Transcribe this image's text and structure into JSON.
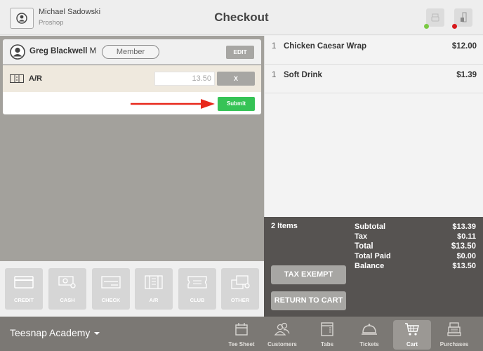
{
  "header": {
    "user_name": "Michael Sadowski",
    "user_role": "Proshop",
    "title": "Checkout",
    "printer_status_color": "#7ac943",
    "drawer_status_color": "#d7191c"
  },
  "customer": {
    "name": "Greg Blackwell",
    "suffix": "M",
    "badge": "Member",
    "edit_label": "EDIT"
  },
  "payment": {
    "method": "A/R",
    "amount": "13.50",
    "remove_label": "X",
    "submit_label": "Submit"
  },
  "tenders": [
    {
      "label": "CREDIT",
      "icon": "credit-card-icon"
    },
    {
      "label": "CASH",
      "icon": "cash-icon"
    },
    {
      "label": "CHECK",
      "icon": "check-icon"
    },
    {
      "label": "A/R",
      "icon": "ar-ledger-icon"
    },
    {
      "label": "CLUB",
      "icon": "club-ticket-icon"
    },
    {
      "label": "OTHER",
      "icon": "other-cards-icon"
    }
  ],
  "cart": {
    "items": [
      {
        "qty": "1",
        "name": "Chicken Caesar Wrap",
        "price": "$12.00"
      },
      {
        "qty": "1",
        "name": "Soft Drink",
        "price": "$1.39"
      }
    ]
  },
  "summary": {
    "items_count": "2 Items",
    "subtotal_label": "Subtotal",
    "subtotal": "$13.39",
    "tax_label": "Tax",
    "tax": "$0.11",
    "total_label": "Total",
    "total": "$13.50",
    "paid_label": "Total Paid",
    "paid": "$0.00",
    "balance_label": "Balance",
    "balance": "$13.50",
    "tax_exempt_label": "TAX EXEMPT",
    "return_label": "RETURN TO CART"
  },
  "nav": {
    "venue": "Teesnap Academy",
    "items": [
      {
        "label": "Tee Sheet",
        "icon": "calendar-icon",
        "active": false
      },
      {
        "label": "Customers",
        "icon": "users-icon",
        "active": false
      },
      {
        "label": "Tabs",
        "icon": "tabs-icon",
        "active": false
      },
      {
        "label": "Tickets",
        "icon": "cloche-icon",
        "active": false
      },
      {
        "label": "Cart",
        "icon": "cart-icon",
        "active": true
      },
      {
        "label": "Purchases",
        "icon": "register-icon",
        "active": false
      }
    ]
  }
}
